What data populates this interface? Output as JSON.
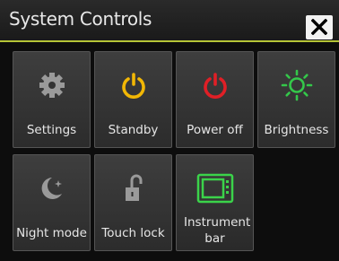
{
  "dialog": {
    "title": "System Controls",
    "close_icon": "close-icon"
  },
  "tiles": [
    {
      "label": "Settings",
      "icon": "gear-icon",
      "color": "#9a9a9a"
    },
    {
      "label": "Standby",
      "icon": "power-icon",
      "color": "#f2b705"
    },
    {
      "label": "Power off",
      "icon": "power-icon",
      "color": "#e01f26"
    },
    {
      "label": "Brightness",
      "icon": "sun-icon",
      "color": "#34c84a"
    },
    {
      "label": "Night mode",
      "icon": "moon-icon",
      "color": "#9a9a9a"
    },
    {
      "label": "Touch lock",
      "icon": "unlock-icon",
      "color": "#9a9a9a"
    },
    {
      "label": "Instrument bar",
      "icon": "instrument-bar-icon",
      "color": "#3bd34a"
    }
  ],
  "colors": {
    "accent": "#b5c436",
    "background": "#0d0d0d",
    "tile": "#353535"
  }
}
